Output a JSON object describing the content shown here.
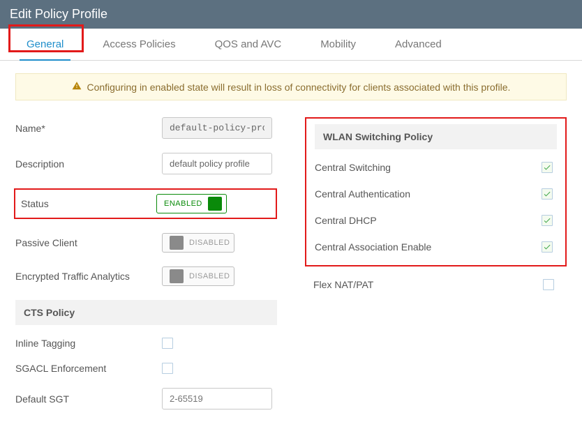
{
  "header": {
    "title": "Edit Policy Profile"
  },
  "tabs": {
    "general": "General",
    "access_policies": "Access Policies",
    "qos": "QOS and AVC",
    "mobility": "Mobility",
    "advanced": "Advanced"
  },
  "alert": {
    "text": "Configuring in enabled state will result in loss of connectivity for clients associated with this profile."
  },
  "form": {
    "name_label": "Name*",
    "name_value": "default-policy-profile",
    "description_label": "Description",
    "description_value": "default policy profile",
    "status_label": "Status",
    "status_value": "ENABLED",
    "passive_client_label": "Passive Client",
    "passive_client_value": "DISABLED",
    "eta_label": "Encrypted Traffic Analytics",
    "eta_value": "DISABLED"
  },
  "cts": {
    "header": "CTS Policy",
    "inline_tagging_label": "Inline Tagging",
    "sgacl_label": "SGACL Enforcement",
    "default_sgt_label": "Default SGT",
    "default_sgt_placeholder": "2-65519"
  },
  "wlan": {
    "header": "WLAN Switching Policy",
    "central_switching": "Central Switching",
    "central_auth": "Central Authentication",
    "central_dhcp": "Central DHCP",
    "central_assoc": "Central Association Enable",
    "flex_nat": "Flex NAT/PAT"
  }
}
